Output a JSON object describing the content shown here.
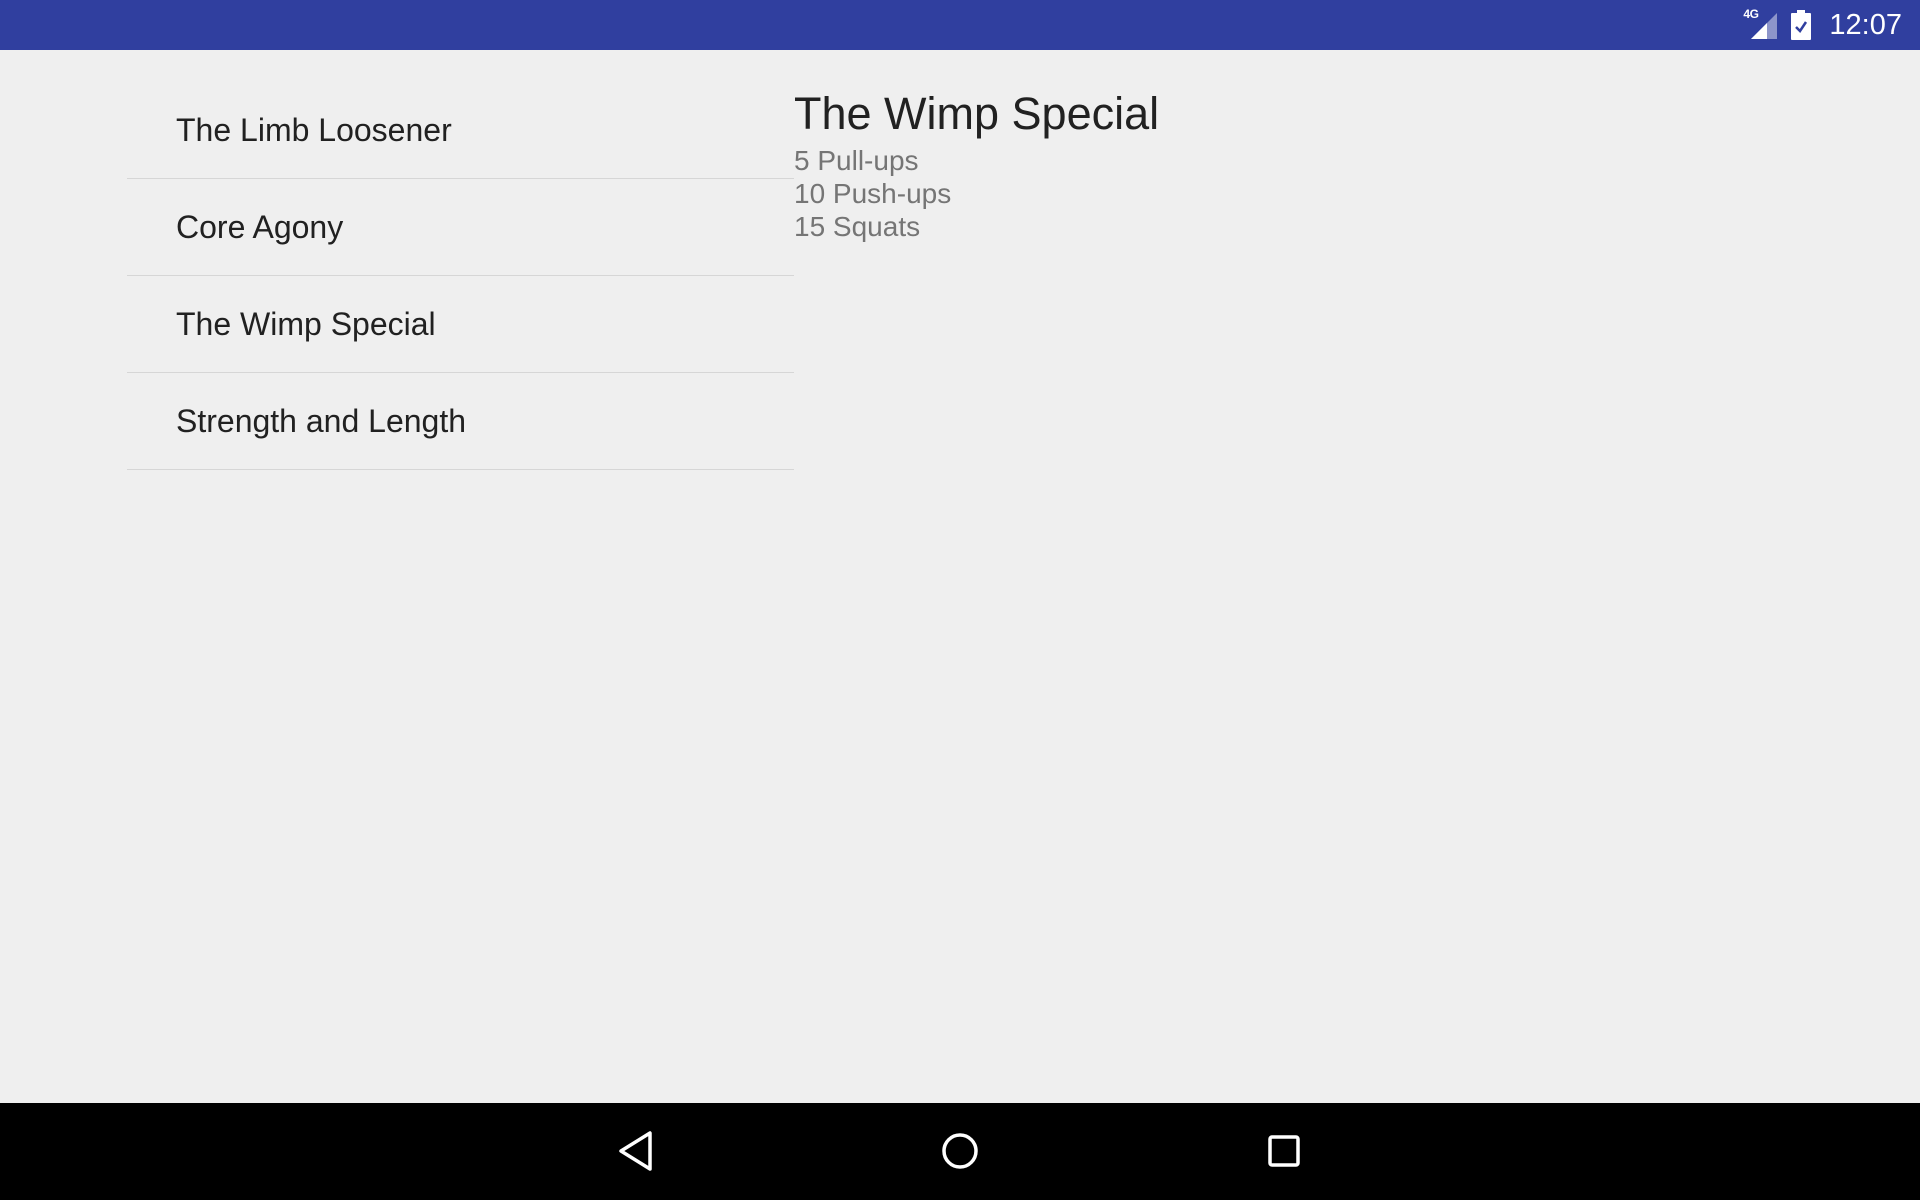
{
  "status_bar": {
    "network_label": "4G",
    "time": "12:07",
    "icons": [
      "signal-icon",
      "battery-icon"
    ],
    "background_color": "#303f9f"
  },
  "workouts": {
    "items": [
      {
        "label": "The Limb Loosener"
      },
      {
        "label": "Core Agony"
      },
      {
        "label": "The Wimp Special"
      },
      {
        "label": "Strength and Length"
      }
    ]
  },
  "detail": {
    "title": "The Wimp Special",
    "lines": [
      "5 Pull-ups",
      "10 Push-ups",
      "15 Squats"
    ]
  },
  "nav_bar": {
    "icons": [
      "back-icon",
      "home-icon",
      "recents-icon"
    ],
    "background_color": "#000000"
  }
}
